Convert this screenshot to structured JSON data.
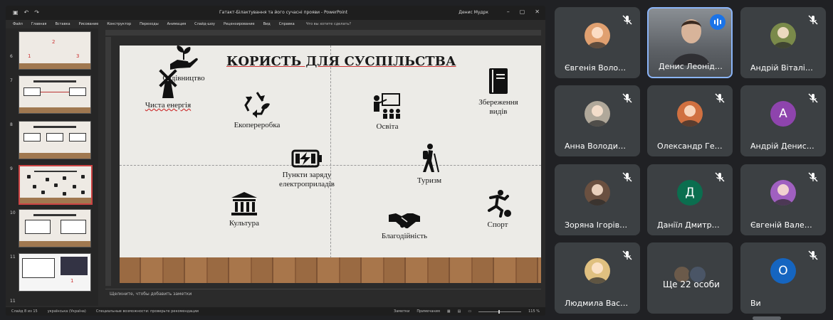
{
  "ppt": {
    "window_title": "Гатакт-Білактування та його сучасні прояви  -  PowerPoint",
    "user_name": "Денис Мудрк",
    "menu": [
      "Файл",
      "Главная",
      "Вставка",
      "Рисование",
      "Конструктор",
      "Переходы",
      "Анимация",
      "Слайд-шоу",
      "Рецензирование",
      "Вид",
      "Справка"
    ],
    "search_hint": "Что вы хотите сделать?",
    "thumb_numbers": [
      "6",
      "7",
      "8",
      "9",
      "10",
      "11"
    ],
    "notes_placeholder": "Щелкните, чтобы добавить заметки",
    "status_left": [
      "Слайд 8 из 15",
      "українська (Україна)",
      "Специальные возможности: проверьте рекомендации"
    ],
    "status_right": [
      "Заметки",
      "Примечания",
      "115 %"
    ]
  },
  "slide": {
    "title": "КОРИСТЬ ДЛЯ СУСПІЛЬСТВА",
    "items": [
      {
        "label": "Чиста енергія",
        "icon": "windmill-icon"
      },
      {
        "label": "Екопереробка",
        "icon": "recycle-icon"
      },
      {
        "label": "Освіта",
        "icon": "teacher-icon"
      },
      {
        "label": "Збереження видів",
        "icon": "book-icon"
      },
      {
        "label": "Садівництво",
        "icon": "plant-hand-icon"
      },
      {
        "label": "Пункти заряду електроприладів",
        "icon": "battery-charge-icon"
      },
      {
        "label": "Туризм",
        "icon": "hiker-icon"
      },
      {
        "label": "Культура",
        "icon": "museum-icon"
      },
      {
        "label": "Благодійність",
        "icon": "handshake-icon"
      },
      {
        "label": "Спорт",
        "icon": "soccer-player-icon"
      }
    ]
  },
  "participants": [
    {
      "name": "Євгенія Воло…",
      "type": "photo",
      "color": "#e0a070"
    },
    {
      "name": "Денис Леонід…",
      "type": "video",
      "speaking": true
    },
    {
      "name": "Андрій Віталі…",
      "type": "photo",
      "color": "#7a8a4a"
    },
    {
      "name": "Анна Володи…",
      "type": "photo",
      "color": "#b0a89a"
    },
    {
      "name": "Олександр Ге…",
      "type": "photo",
      "color": "#d07040"
    },
    {
      "name": "Андрій Денис…",
      "type": "letter",
      "letter": "А",
      "color": "#8e44ad"
    },
    {
      "name": "Зоряна Ігорів…",
      "type": "photo",
      "color": "#6a5040"
    },
    {
      "name": "Даніїл Дмитр…",
      "type": "letter",
      "letter": "Д",
      "color": "#0b6e4f"
    },
    {
      "name": "Євгеній Вале…",
      "type": "photo",
      "color": "#a060c0"
    },
    {
      "name": "Людмила Вас…",
      "type": "photo",
      "color": "#e0c080"
    },
    {
      "name": "Ще 22 особи",
      "type": "more"
    },
    {
      "name": "Ви",
      "type": "letter",
      "letter": "О",
      "color": "#1565c0"
    }
  ],
  "colors": {
    "meet_bg": "#202124",
    "tile_bg": "#3c4043",
    "accent": "#1a73e8"
  }
}
